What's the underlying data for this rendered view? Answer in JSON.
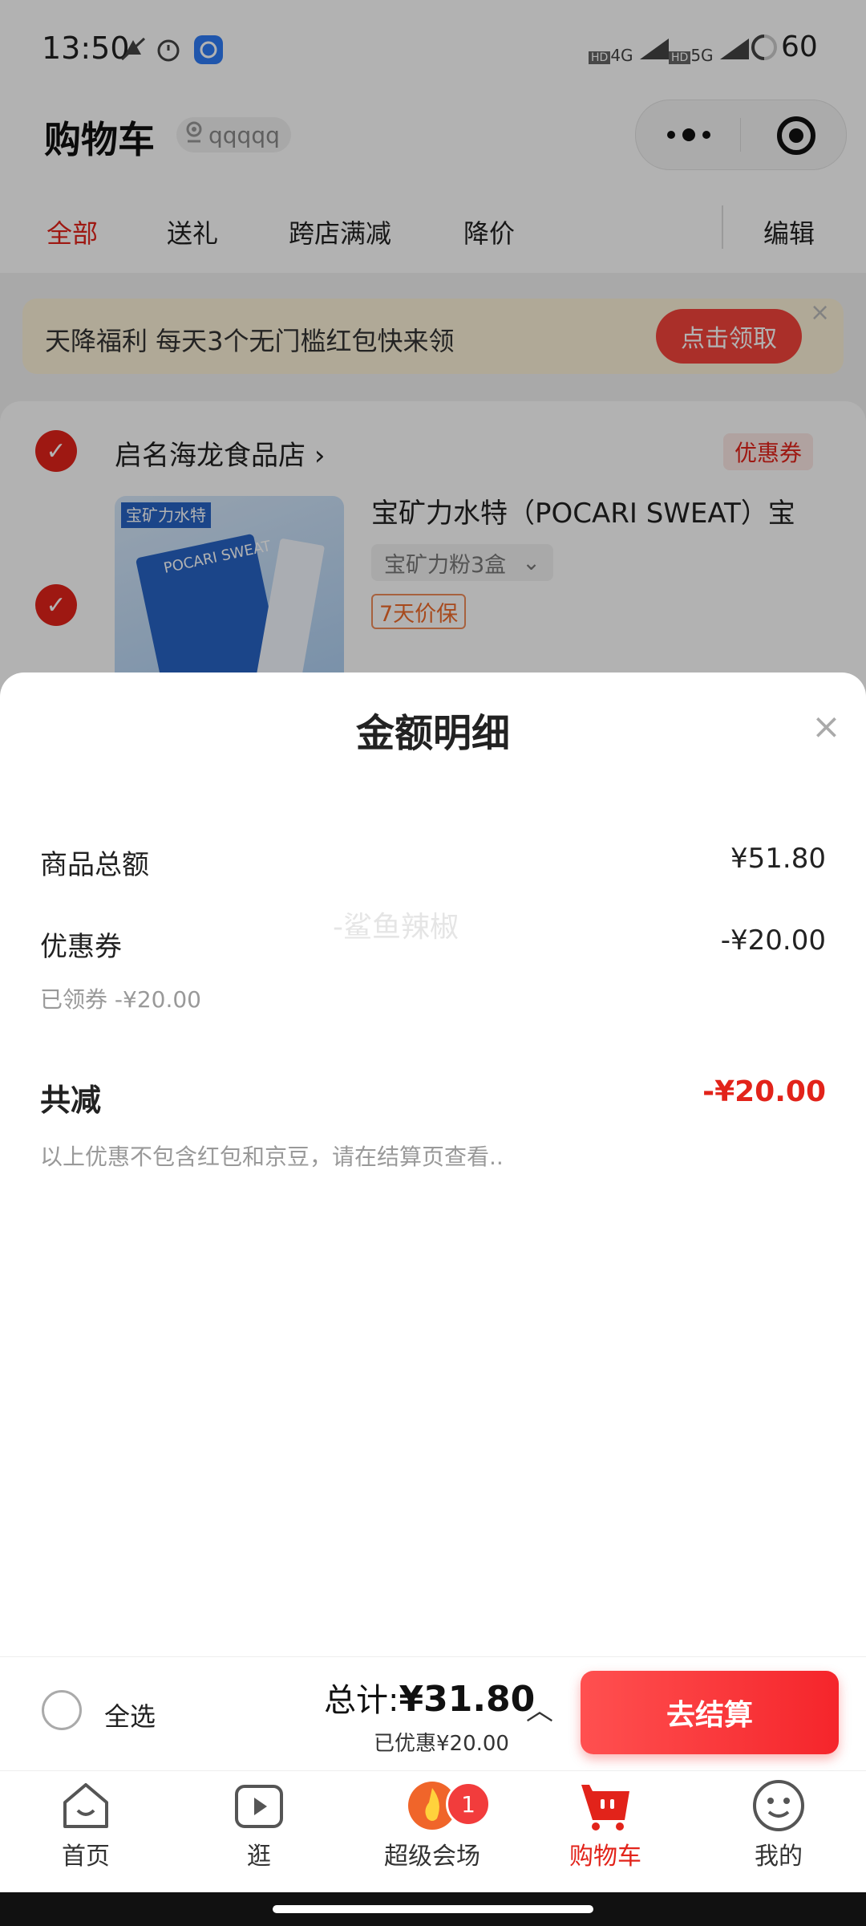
{
  "status_bar": {
    "time": "13:50",
    "network1": "4G",
    "network2": "5G",
    "battery": "60"
  },
  "header": {
    "title": "购物车",
    "location": "qqqqq"
  },
  "tabs": [
    {
      "label": "全部"
    },
    {
      "label": "送礼"
    },
    {
      "label": "跨店满减"
    },
    {
      "label": "降价"
    }
  ],
  "edit_label": "编辑",
  "banner": {
    "text": "天降福利 每天3个无门槛红包快来领",
    "button": "点击领取"
  },
  "store": {
    "name": "启名海龙食品店",
    "coupon_tag": "优惠券",
    "product": {
      "title": "宝矿力水特（POCARI SWEAT）宝",
      "spec": "宝矿力粉3盒",
      "guarantee": "7天价保",
      "image_brand": "宝矿力水特",
      "image_text": "POCARI SWEAT"
    }
  },
  "sheet": {
    "title": "金额明细",
    "watermark": "-鲨鱼辣椒",
    "rows": [
      {
        "label": "商品总额",
        "value": "¥51.80"
      },
      {
        "label": "优惠券",
        "value": "-¥20.00",
        "sub": "已领券 -¥20.00"
      }
    ],
    "total": {
      "label": "共减",
      "value": "-¥20.00",
      "note": "以上优惠不包含红包和京豆，请在结算页查看.."
    }
  },
  "checkout": {
    "select_all": "全选",
    "total_prefix": "总计:",
    "total_value": "¥31.80",
    "saved": "已优惠¥20.00",
    "button": "去结算"
  },
  "bottom_nav": [
    {
      "label": "首页",
      "icon": "home-icon"
    },
    {
      "label": "逛",
      "icon": "video-icon"
    },
    {
      "label": "超级会场",
      "icon": "fire-icon"
    },
    {
      "label": "购物车",
      "icon": "cart-icon"
    },
    {
      "label": "我的",
      "icon": "profile-icon"
    }
  ],
  "badge_count": "1",
  "colors": {
    "accent": "#e2231a",
    "banner_bg": "#fdf2d8"
  }
}
